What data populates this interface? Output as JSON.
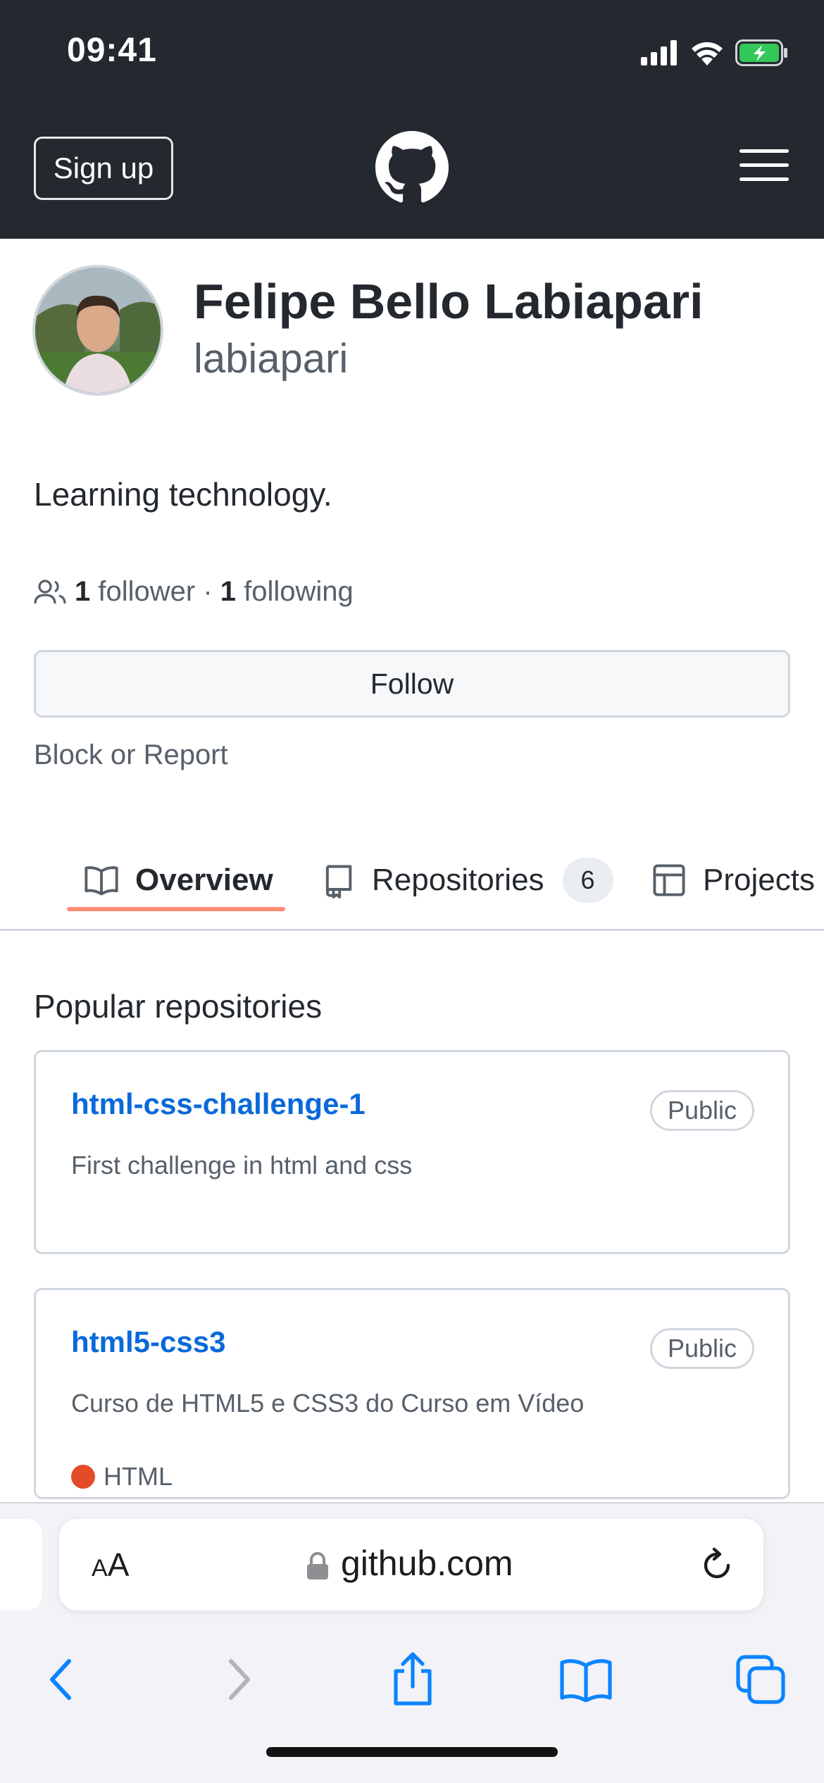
{
  "status_bar": {
    "time": "09:41"
  },
  "header": {
    "signup_label": "Sign up"
  },
  "profile": {
    "name": "Felipe Bello Labiapari",
    "login": "labiapari",
    "bio": "Learning technology.",
    "followers_count": "1",
    "followers_label": "follower",
    "separator": " · ",
    "following_count": "1",
    "following_label": "following",
    "follow_button": "Follow",
    "block_link": "Block or Report"
  },
  "tabs": [
    {
      "label": "Overview",
      "icon": "book-icon",
      "active": true
    },
    {
      "label": "Repositories",
      "icon": "repo-icon",
      "count": "6"
    },
    {
      "label": "Projects",
      "icon": "table-icon"
    }
  ],
  "popular": {
    "title": "Popular repositories",
    "repos": [
      {
        "name": "html-css-challenge-1",
        "visibility": "Public",
        "description": "First challenge in html and css"
      },
      {
        "name": "html5-css3",
        "visibility": "Public",
        "description": "Curso de HTML5 e CSS3 do Curso em Vídeo",
        "language": "HTML",
        "language_color": "#e34c26"
      }
    ]
  },
  "browser": {
    "aa_small": "A",
    "aa_large": "A",
    "url": "github.com"
  },
  "colors": {
    "header_bg": "#24292f",
    "link": "#0969da",
    "tab_underline": "#fd8c73",
    "ios_blue": "#0a84ff"
  }
}
